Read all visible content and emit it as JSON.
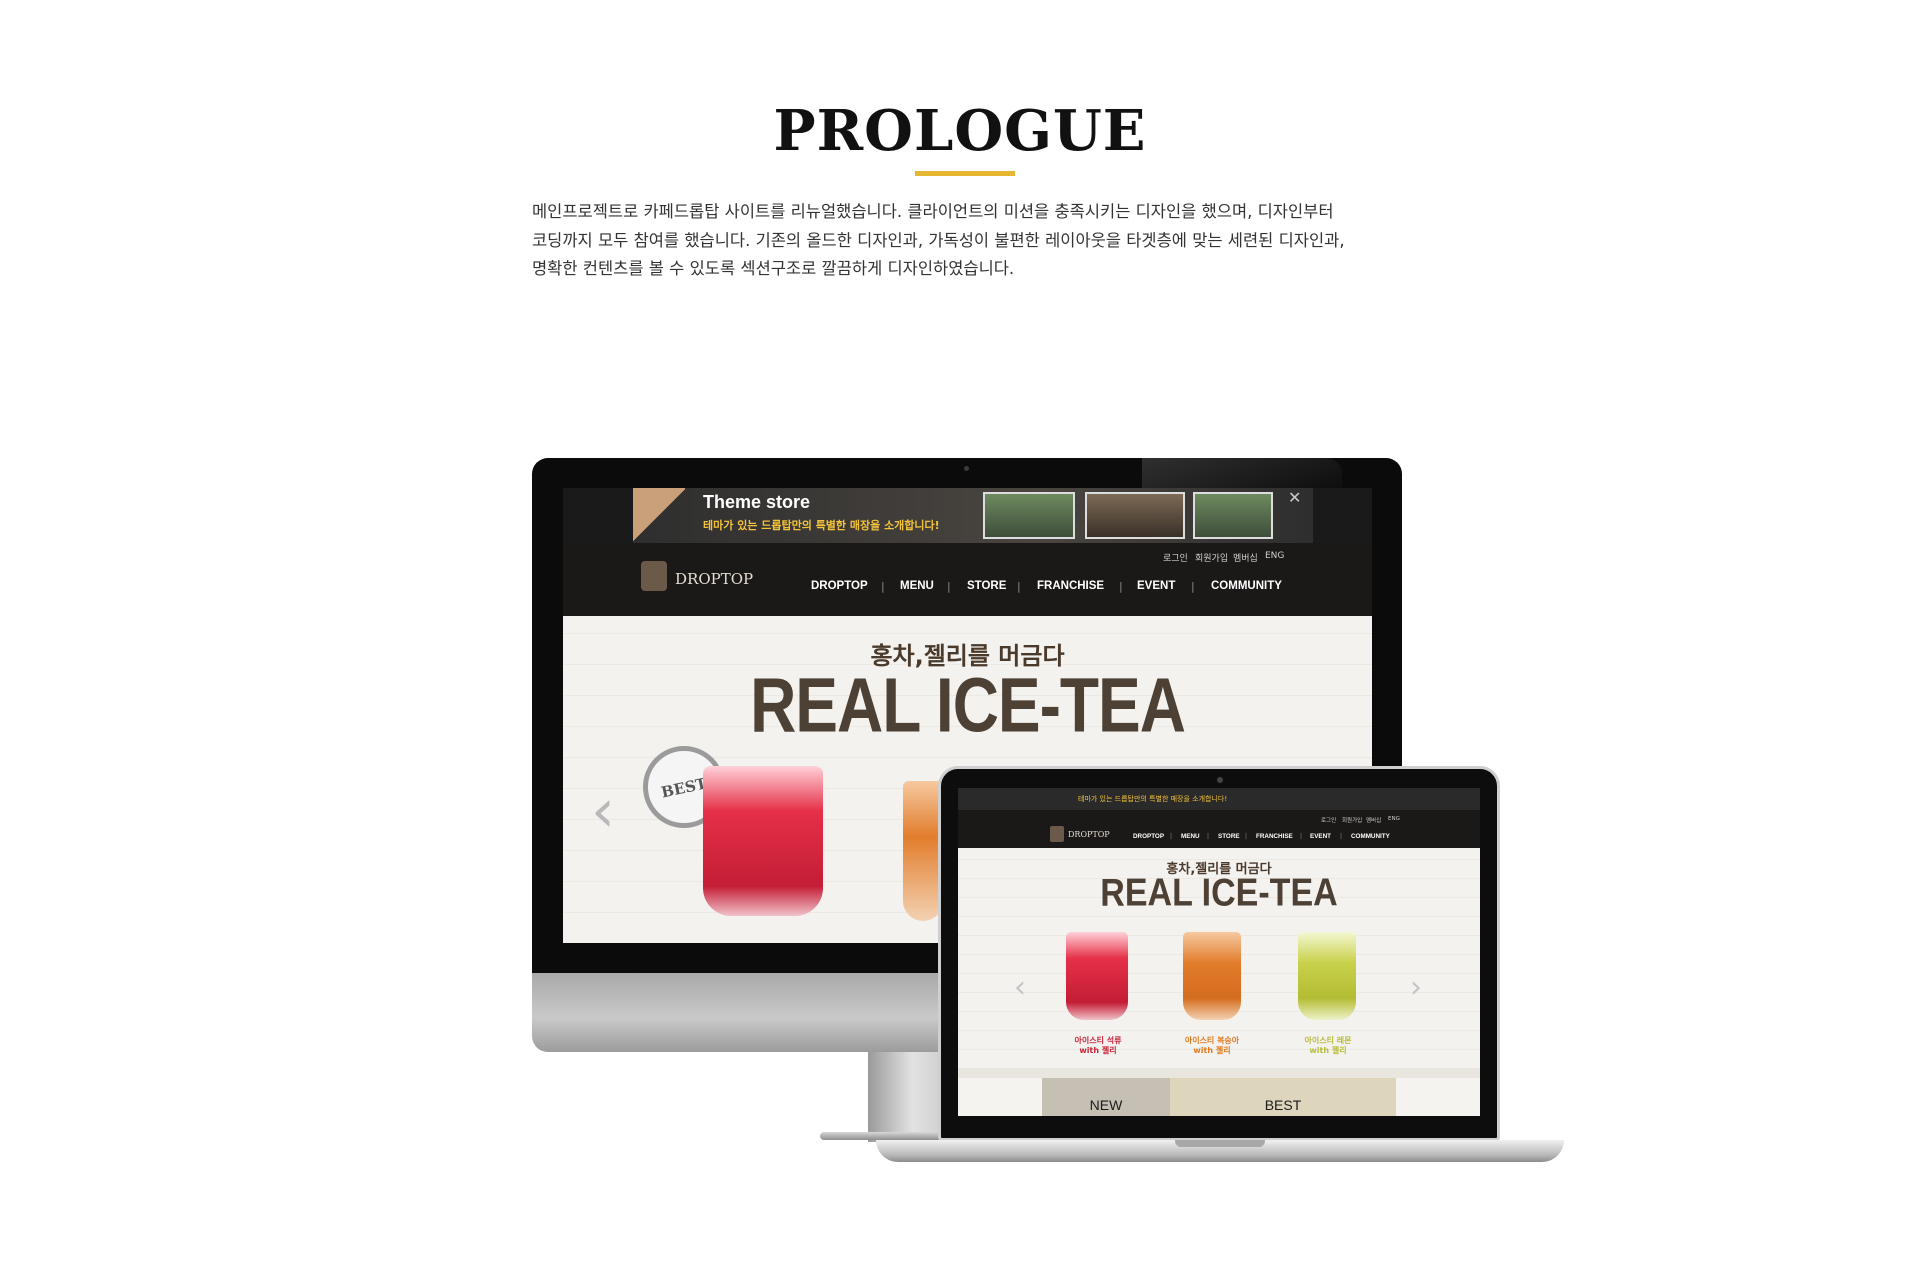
{
  "header": {
    "title": "PROLOGUE",
    "description": "메인프로젝트로 카페드롭탑 사이트를 리뉴얼했습니다. 클라이언트의 미션을 충족시키는 디자인을 했으며, 디자인부터\n코딩까지 모두 참여를 했습니다. 기존의 올드한 디자인과, 가독성이 불편한 레이아웃을  타겟층에 맞는 세련된 디자인과,\n명확한 컨텐츠를 볼 수 있도록 섹션구조로  깔끔하게 디자인하였습니다."
  },
  "accent_color": "#e6b733",
  "mockup": {
    "banner": {
      "title": "Theme store",
      "subtitle": "테마가 있는 드롭탑만의 특별한 매장을 소개합니다!"
    },
    "site": {
      "logo_text": "DROPTOP",
      "util_links": [
        "로그인",
        "회원가입",
        "멤버십",
        "ENG"
      ],
      "nav": [
        "DROPTOP",
        "MENU",
        "STORE",
        "FRANCHISE",
        "EVENT",
        "COMMUNITY"
      ],
      "nav_separator": "|",
      "hero_kor": "홍차,젤리를 머금다",
      "hero_eng": "REAL ICE-TEA",
      "badge": "BEST",
      "products": [
        {
          "name": "아이스티 석류\nwith 젤리",
          "color": "#d4213a"
        },
        {
          "name": "아이스티 복숭아\nwith 젤리",
          "color": "#e07a1f"
        },
        {
          "name": "아이스티 레몬\nwith 젤리",
          "color": "#b7bb3a"
        }
      ],
      "tabs": [
        "NEW",
        "BEST"
      ]
    }
  }
}
